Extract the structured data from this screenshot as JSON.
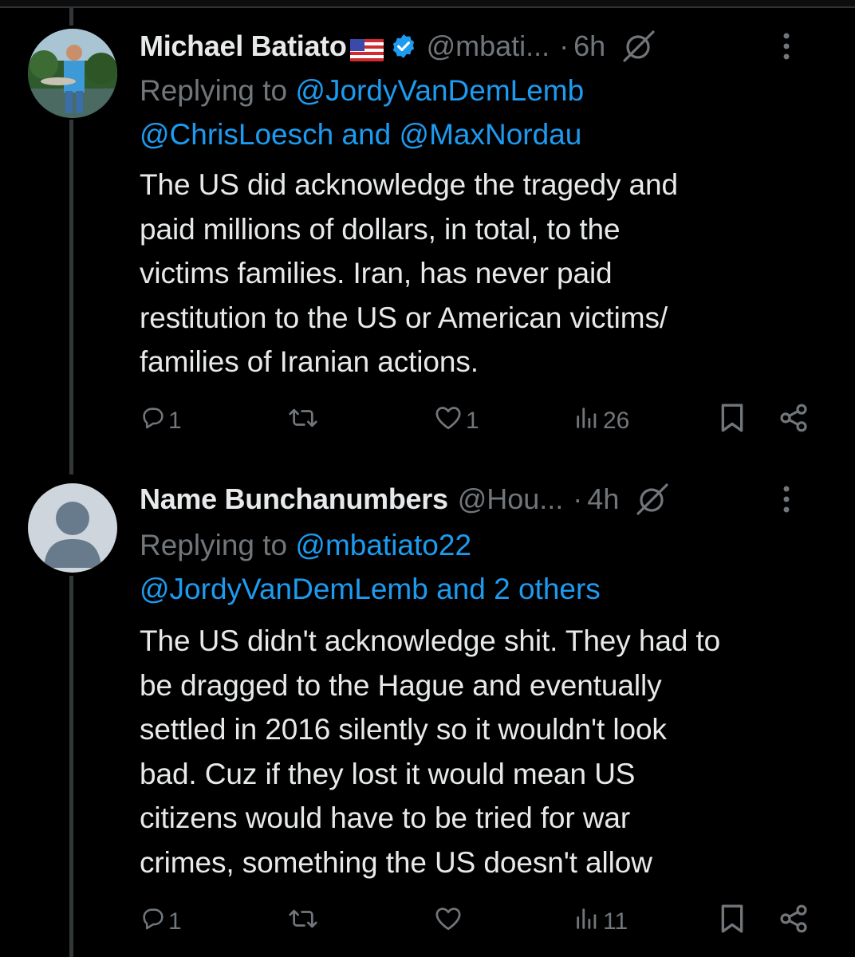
{
  "tweets": [
    {
      "name": "Michael Batiato",
      "flag_emoji": "🇺🇸",
      "verified": true,
      "handle": "@mbati...",
      "dot": "·",
      "time": "6h",
      "replying_prefix": "Replying to",
      "replying_line1_mention": "@JordyVanDemLemb",
      "replying_line2_a": "@ChrisLoesch",
      "replying_line2_and": "and",
      "replying_line2_b": "@MaxNordau",
      "body_lines": [
        "The US did acknowledge the tragedy and",
        "paid millions of dollars, in total, to the",
        "victims families. Iran, has never paid",
        "restitution to the US or American victims/",
        "families of Iranian actions."
      ],
      "replies": "1",
      "reposts": "",
      "likes": "1",
      "views": "26"
    },
    {
      "name": "Name Bunchanumbers",
      "verified": false,
      "handle": "@Hou...",
      "dot": "·",
      "time": "4h",
      "replying_prefix": "Replying to",
      "replying_line1_mention": "@mbatiato22",
      "replying_line2_a": "@JordyVanDemLemb",
      "replying_line2_and": "and 2 others",
      "body_lines": [
        "The US didn't acknowledge shit. They had to",
        "be dragged to the Hague and eventually",
        "settled in 2016 silently so it wouldn't look",
        "bad. Cuz if they lost it would mean US",
        "citizens would have to be tried for war",
        "crimes, something the US doesn't allow"
      ],
      "replies": "1",
      "reposts": "",
      "likes": "",
      "views": "11"
    }
  ],
  "icons": {
    "reply": "reply-icon",
    "repost": "repost-icon",
    "like": "heart-icon",
    "views": "views-icon",
    "bookmark": "bookmark-icon",
    "share": "share-icon",
    "grok": "grok-icon",
    "more": "more-icon"
  },
  "colors": {
    "background": "#000000",
    "text": "#e7e9ea",
    "muted": "#71767b",
    "link": "#1d9bf0",
    "thread_line": "#333639"
  }
}
